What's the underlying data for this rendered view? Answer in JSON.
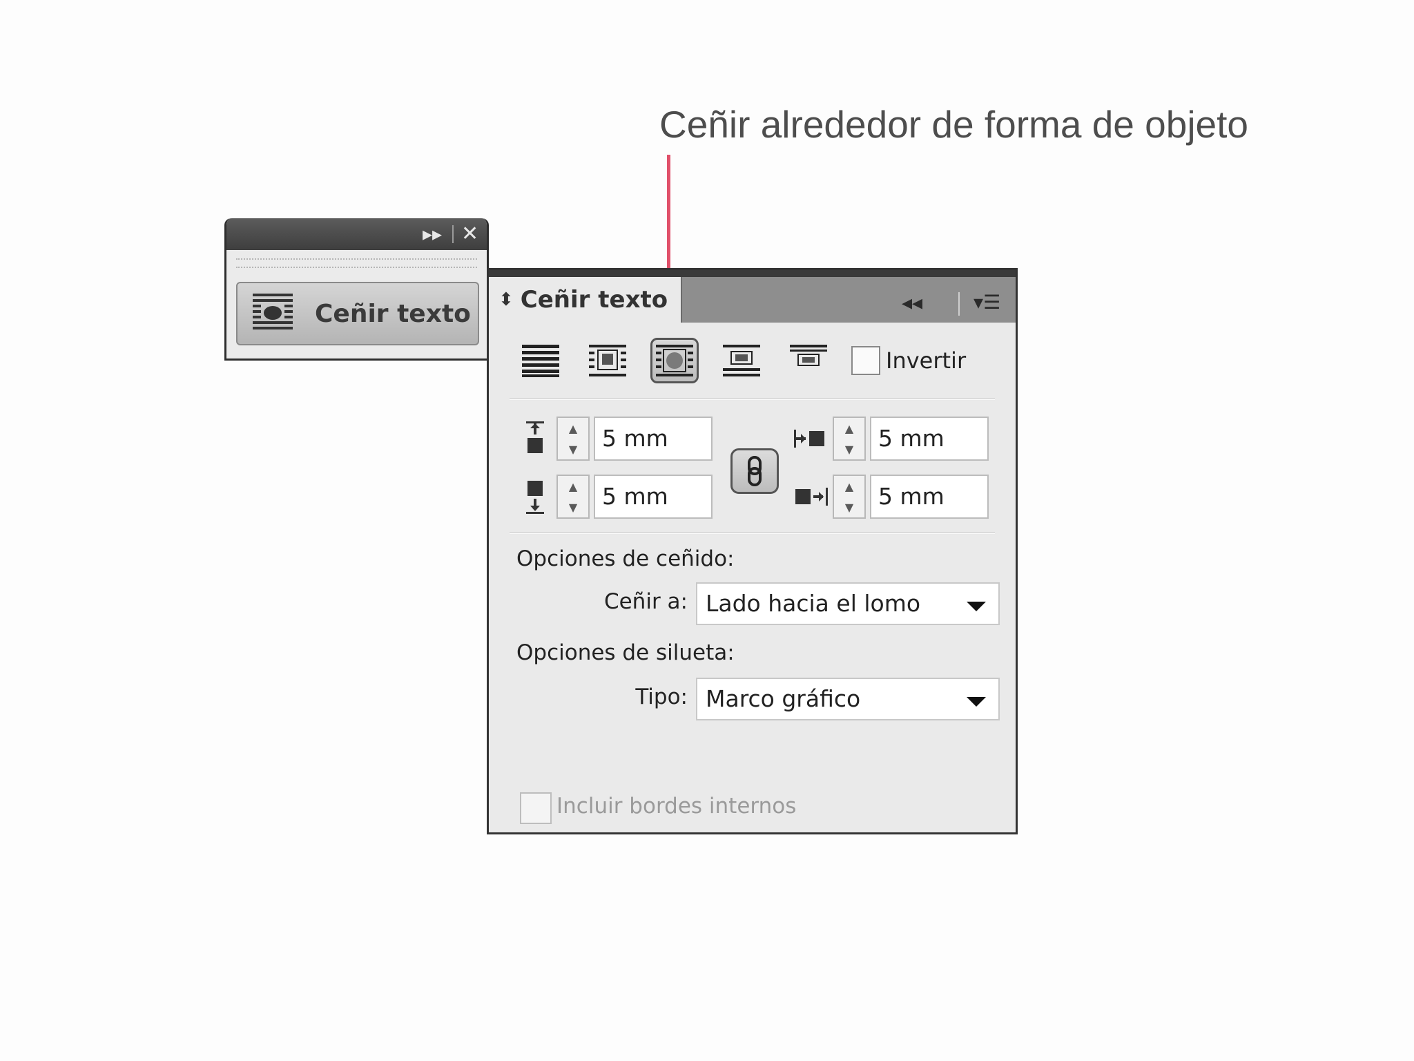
{
  "callout": {
    "text": "Ceñir alrededor de forma de objeto",
    "color": "#e0506a"
  },
  "mini_panel": {
    "expand_icon": "double-chevron-right-icon",
    "close_icon": "close-icon",
    "button_label": "Ceñir texto"
  },
  "panel": {
    "tab_title": "Ceñir texto",
    "collapse_icon": "double-chevron-left-icon",
    "menu_icon": "panel-menu-icon",
    "wrap_modes": [
      "no-text-wrap",
      "wrap-around-bounding-box",
      "wrap-around-object-shape",
      "jump-object",
      "jump-to-next-column"
    ],
    "active_wrap_mode": "wrap-around-object-shape",
    "invert_label": "Invertir",
    "offsets": {
      "top": "5 mm",
      "bottom": "5 mm",
      "left": "5 mm",
      "right": "5 mm"
    },
    "wrap_options_heading": "Opciones de ceñido:",
    "wrap_to_label": "Ceñir a:",
    "wrap_to_value": "Lado hacia el lomo",
    "contour_options_heading": "Opciones de silueta:",
    "type_label": "Tipo:",
    "type_value": "Marco gráfico",
    "include_inside_edges_label": "Incluir bordes internos"
  }
}
